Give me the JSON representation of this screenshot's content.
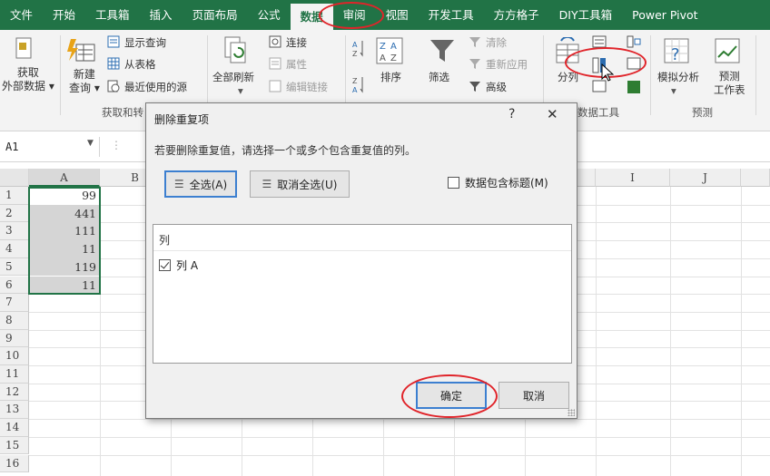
{
  "ribbon_tabs": [
    "文件",
    "开始",
    "工具箱",
    "插入",
    "页面布局",
    "公式",
    "数据",
    "审阅",
    "视图",
    "开发工具",
    "方方格子",
    "DIY工具箱",
    "Power Pivot"
  ],
  "ribbon": {
    "get_external": "获取\n外部数据 ▾",
    "new_query": "新建\n查询 ▾",
    "show_query": "显示查询",
    "from_table": "从表格",
    "recent_sources": "最近使用的源",
    "group_get": "获取和转",
    "refresh_all": "全部刷新",
    "connections": "连接",
    "properties": "属性",
    "edit_links": "编辑链接",
    "sort": "排序",
    "filter": "筛选",
    "clear": "清除",
    "reapply": "重新应用",
    "advanced": "高级",
    "text_to_columns": "分列",
    "group_data_tools": "数据工具",
    "what_if": "模拟分析",
    "forecast": "预测\n工作表",
    "group_forecast": "预测"
  },
  "formula_bar": {
    "name_box": "A1"
  },
  "grid": {
    "columns": [
      "A",
      "B",
      "",
      "",
      "",
      "",
      "",
      "",
      "I",
      "J"
    ],
    "rows": [
      "1",
      "2",
      "3",
      "4",
      "5",
      "6",
      "7",
      "8",
      "9",
      "10",
      "11",
      "12",
      "13",
      "14",
      "15",
      "16"
    ],
    "values": [
      "99",
      "441",
      "111",
      "11",
      "119",
      "11"
    ]
  },
  "dialog": {
    "title": "删除重复项",
    "help": "?",
    "close": "✕",
    "instruction": "若要删除重复值，请选择一个或多个包含重复值的列。",
    "select_all": "全选(A)",
    "unselect_all": "取消全选(U)",
    "has_headers": "数据包含标题(M)",
    "has_headers_checked": false,
    "list_header": "列",
    "columns": [
      {
        "label": "列 A",
        "checked": true
      }
    ],
    "ok": "确定",
    "cancel": "取消"
  },
  "colors": {
    "excel_green": "#217346",
    "annotation_red": "#e0242a",
    "selection_gray": "#d5d5d5"
  }
}
